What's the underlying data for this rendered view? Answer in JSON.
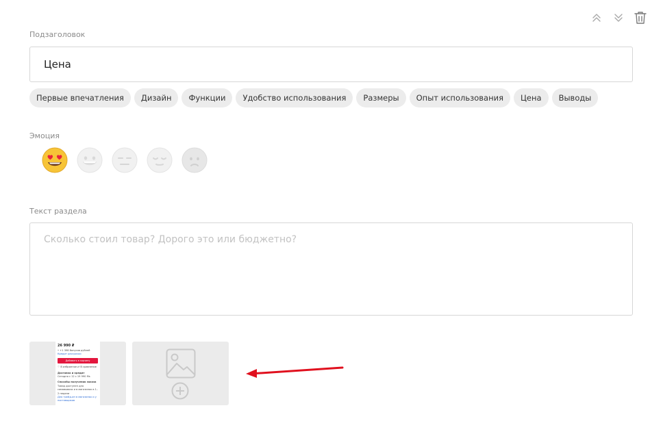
{
  "section": {
    "subheading_label": "Подзаголовок",
    "subheading_value": "Цена",
    "emotion_label": "Эмоция",
    "text_label": "Текст раздела",
    "text_placeholder": "Сколько стоил товар? Дорого это или бюджетно?"
  },
  "tags": [
    "Первые впечатления",
    "Дизайн",
    "Функции",
    "Удобство использования",
    "Размеры",
    "Опыт использования",
    "Цена",
    "Выводы"
  ],
  "emotions": {
    "options": [
      "heart-eyes-emoji",
      "grinning-emoji",
      "neutral-emoji",
      "relieved-emoji",
      "frowning-emoji"
    ],
    "selected_index": 0
  },
  "toolbar_icons": [
    "chevrons-up-icon",
    "chevrons-down-icon",
    "trash-icon"
  ],
  "thumbnail": {
    "price": "26 990 ₽",
    "note_1": "• +1 398 бонусов рублей",
    "link_1": "Кредит рассрочки",
    "button": "Добавить в корзину",
    "fav": "♡ В избранное   ⇄ В сравнение",
    "delivery_title": "Доставка и кредит",
    "delivery_text": "Сегодня с 12 с 19 990 Ms",
    "pickup_title": "Способы получения заказа",
    "pickup_text": "Товар доступен для самовывоза и в магазинах в 1–2 недели",
    "link_2": "Для трейд-ин в магазинах и у поставщиков"
  },
  "colors": {
    "accent_red": "#e3173e",
    "chip_bg": "#ececec",
    "border": "#d6d6d6",
    "label": "#8a8a8a",
    "placeholder": "#c2c2c2",
    "arrow": "#e0101e"
  }
}
